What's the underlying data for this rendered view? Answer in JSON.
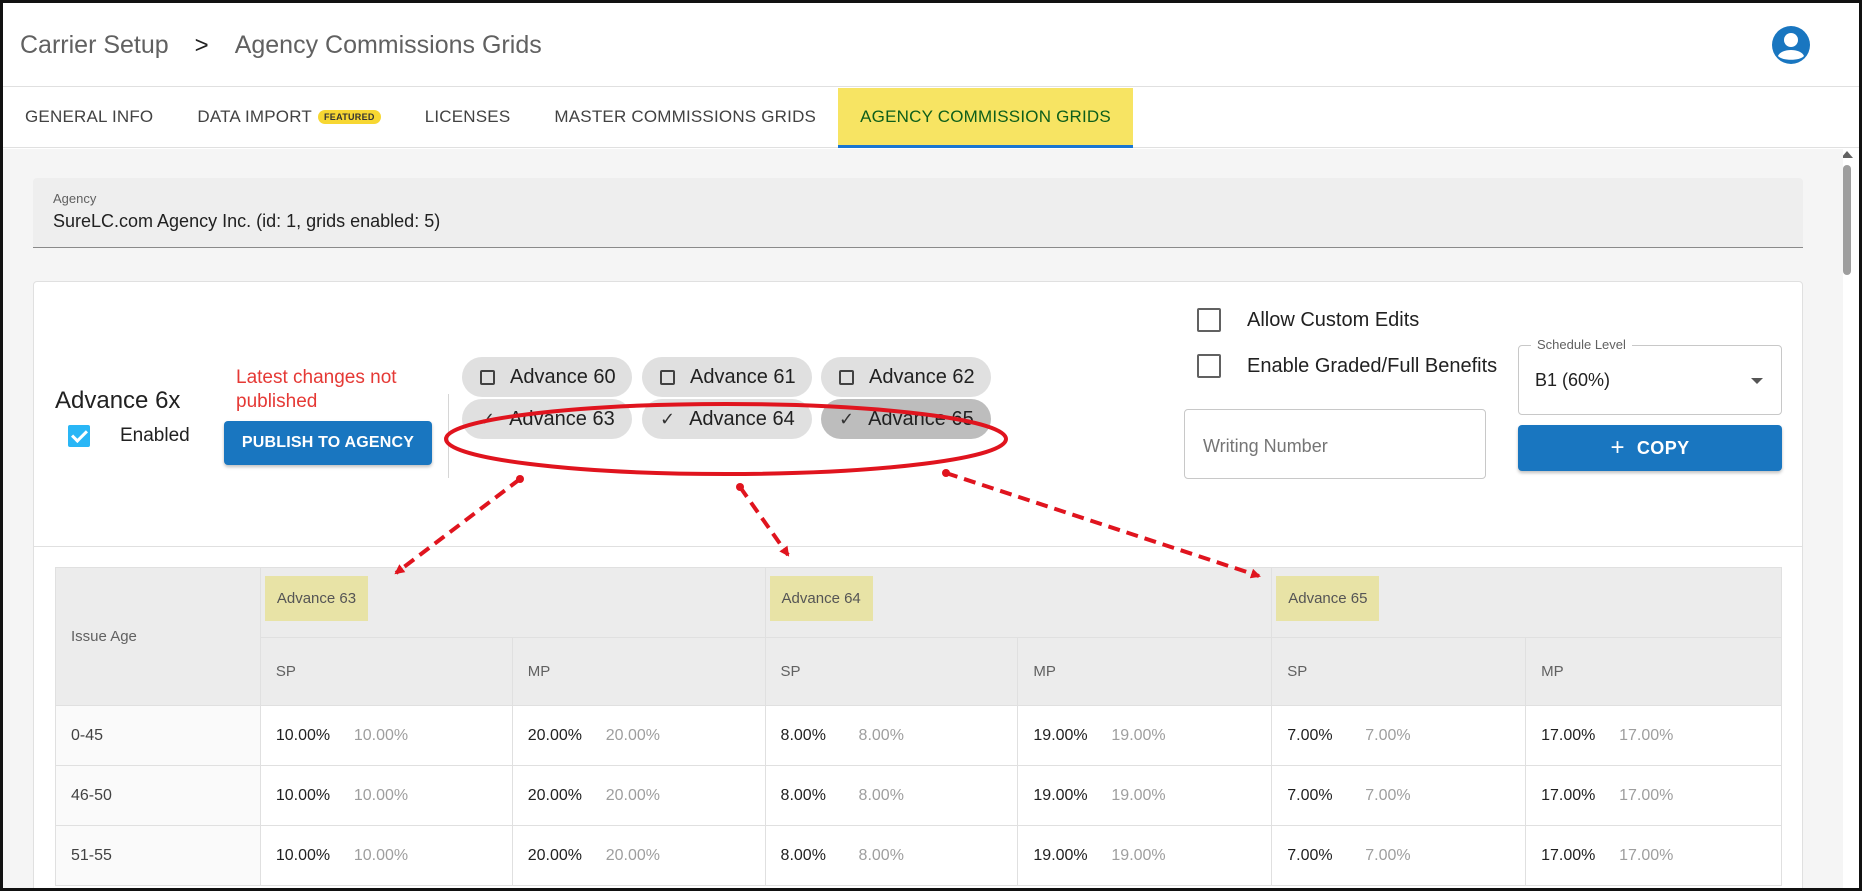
{
  "breadcrumb": {
    "parent": "Carrier Setup",
    "separator": ">",
    "current": "Agency Commissions Grids"
  },
  "tabs": [
    {
      "label": "GENERAL INFO"
    },
    {
      "label": "DATA IMPORT",
      "badge": "FEATURED"
    },
    {
      "label": "LICENSES"
    },
    {
      "label": "MASTER COMMISSIONS GRIDS"
    },
    {
      "label": "AGENCY COMMISSION GRIDS",
      "active": true
    }
  ],
  "agency": {
    "label": "Agency",
    "value": "SureLC.com Agency Inc. (id: 1, grids enabled: 5)"
  },
  "grid": {
    "title": "Advance 6x",
    "enabled_label": "Enabled",
    "enabled": true,
    "warning": "Latest changes not published",
    "publish_label": "PUBLISH TO AGENCY"
  },
  "chips": [
    {
      "label": "Advance 60",
      "checked": false
    },
    {
      "label": "Advance 61",
      "checked": false
    },
    {
      "label": "Advance 62",
      "checked": false
    },
    {
      "label": "Advance 63",
      "checked": true
    },
    {
      "label": "Advance 64",
      "checked": true
    },
    {
      "label": "Advance 65",
      "checked": true
    }
  ],
  "options": {
    "allow_custom_edits": "Allow Custom Edits",
    "enable_graded": "Enable Graded/Full Benefits"
  },
  "schedule": {
    "label": "Schedule Level",
    "value": "B1 (60%)"
  },
  "writing_number": {
    "placeholder": "Writing Number"
  },
  "copy_label": "COPY",
  "table": {
    "issue_age_header": "Issue Age",
    "groups": [
      "Advance 63",
      "Advance 64",
      "Advance 65"
    ],
    "sub_headers": [
      "SP",
      "MP"
    ],
    "rows": [
      {
        "age": "0-45",
        "cells": [
          [
            "10.00%",
            "10.00%"
          ],
          [
            "20.00%",
            "20.00%"
          ],
          [
            "8.00%",
            "8.00%"
          ],
          [
            "19.00%",
            "19.00%"
          ],
          [
            "7.00%",
            "7.00%"
          ],
          [
            "17.00%",
            "17.00%"
          ]
        ]
      },
      {
        "age": "46-50",
        "cells": [
          [
            "10.00%",
            "10.00%"
          ],
          [
            "20.00%",
            "20.00%"
          ],
          [
            "8.00%",
            "8.00%"
          ],
          [
            "19.00%",
            "19.00%"
          ],
          [
            "7.00%",
            "7.00%"
          ],
          [
            "17.00%",
            "17.00%"
          ]
        ]
      },
      {
        "age": "51-55",
        "cells": [
          [
            "10.00%",
            "10.00%"
          ],
          [
            "20.00%",
            "20.00%"
          ],
          [
            "8.00%",
            "8.00%"
          ],
          [
            "19.00%",
            "19.00%"
          ],
          [
            "7.00%",
            "7.00%"
          ],
          [
            "17.00%",
            "17.00%"
          ]
        ]
      }
    ]
  },
  "colors": {
    "primary": "#1976c0",
    "active_tab": "#f7e463",
    "warning": "#e53935",
    "annotation": "#e0141e"
  }
}
